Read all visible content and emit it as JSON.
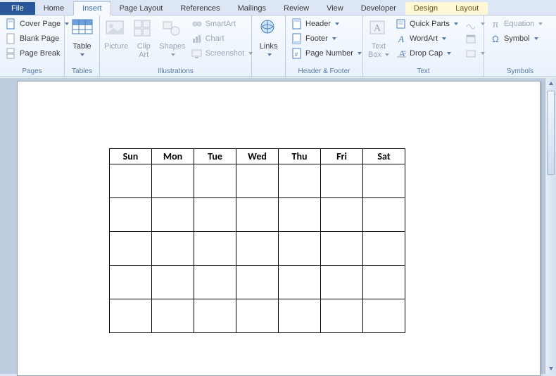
{
  "tabs": {
    "file": "File",
    "home": "Home",
    "insert": "Insert",
    "pageLayout": "Page Layout",
    "references": "References",
    "mailings": "Mailings",
    "review": "Review",
    "view": "View",
    "developer": "Developer",
    "design": "Design",
    "layout": "Layout"
  },
  "groups": {
    "pages": {
      "label": "Pages",
      "coverPage": "Cover Page",
      "blankPage": "Blank Page",
      "pageBreak": "Page Break"
    },
    "tables": {
      "label": "Tables",
      "table": "Table"
    },
    "illustrations": {
      "label": "Illustrations",
      "picture": "Picture",
      "clipArt": "Clip Art",
      "shapes": "Shapes",
      "smartArt": "SmartArt",
      "chart": "Chart",
      "screenshot": "Screenshot"
    },
    "links": {
      "label": "Links",
      "links": "Links"
    },
    "headerFooter": {
      "label": "Header & Footer",
      "header": "Header",
      "footer": "Footer",
      "pageNumber": "Page Number"
    },
    "text": {
      "label": "Text",
      "textBox": "Text Box",
      "quickParts": "Quick Parts",
      "wordArt": "WordArt",
      "dropCap": "Drop Cap"
    },
    "symbols": {
      "label": "Symbols",
      "equation": "Equation",
      "symbol": "Symbol"
    }
  },
  "calendar": {
    "days": [
      "Sun",
      "Mon",
      "Tue",
      "Wed",
      "Thu",
      "Fri",
      "Sat"
    ],
    "rows": 5
  }
}
